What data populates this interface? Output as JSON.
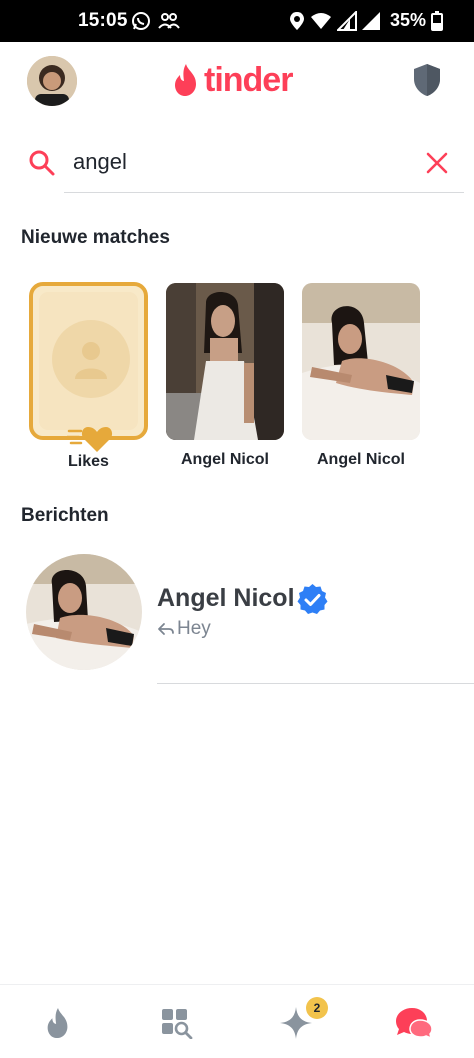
{
  "status_bar": {
    "time": "15:05",
    "battery": "35%",
    "icons": [
      "whatsapp-icon",
      "people-icon",
      "location-icon",
      "wifi-icon",
      "signal-icon",
      "signal-icon",
      "battery-icon"
    ]
  },
  "header": {
    "logo_text": "tinder",
    "icons": {
      "left": "profile-avatar",
      "right": "shield-icon"
    }
  },
  "search": {
    "value": "angel",
    "icon": "search-icon",
    "clear_icon": "close-icon"
  },
  "new_matches": {
    "title": "Nieuwe matches",
    "likes_label": "Likes",
    "matches": [
      {
        "name": "Angel Nicol"
      },
      {
        "name": "Angel Nicol"
      }
    ]
  },
  "messages": {
    "title": "Berichten",
    "items": [
      {
        "name": "Angel Nicol",
        "verified": true,
        "preview": "Hey",
        "preview_icon": "reply-arrow-icon"
      }
    ]
  },
  "bottom_nav": {
    "items": [
      "flame-icon",
      "explore-icon",
      "sparkle-icon",
      "chat-icon"
    ],
    "badge": "2",
    "active": "chat-icon"
  },
  "colors": {
    "brand": "#fd3f58",
    "gold": "#e6a93b",
    "verified": "#2e7ff6",
    "text": "#21262e"
  }
}
